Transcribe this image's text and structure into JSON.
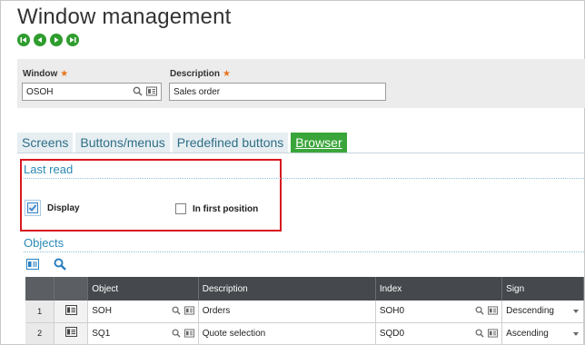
{
  "page": {
    "title": "Window management"
  },
  "nav": [
    "first-record-icon",
    "previous-record-icon",
    "next-record-icon",
    "last-record-icon"
  ],
  "header": {
    "window": {
      "label": "Window",
      "value": "OSOH"
    },
    "description": {
      "label": "Description",
      "value": "Sales order"
    },
    "required_mark": "★"
  },
  "tabs": [
    {
      "label": "Screens"
    },
    {
      "label": "Buttons/menus"
    },
    {
      "label": "Predefined buttons"
    },
    {
      "label": "Browser"
    }
  ],
  "last_read": {
    "title": "Last read",
    "display": {
      "label": "Display",
      "checked": true
    },
    "first_position": {
      "label": "In first position",
      "checked": false
    }
  },
  "objects": {
    "title": "Objects",
    "columns": [
      "Object",
      "Description",
      "Index",
      "Sign"
    ],
    "rows": [
      {
        "num": "1",
        "object": "SOH",
        "description": "Orders",
        "index": "SOH0",
        "sign": "Descending"
      },
      {
        "num": "2",
        "object": "SQ1",
        "description": "Quote selection",
        "index": "SQD0",
        "sign": "Ascending"
      }
    ]
  },
  "colors": {
    "accent_green": "#3aa53a",
    "link_blue": "#2a8ab5",
    "highlight_red": "#d7181f",
    "grid_header": "#45494d"
  }
}
